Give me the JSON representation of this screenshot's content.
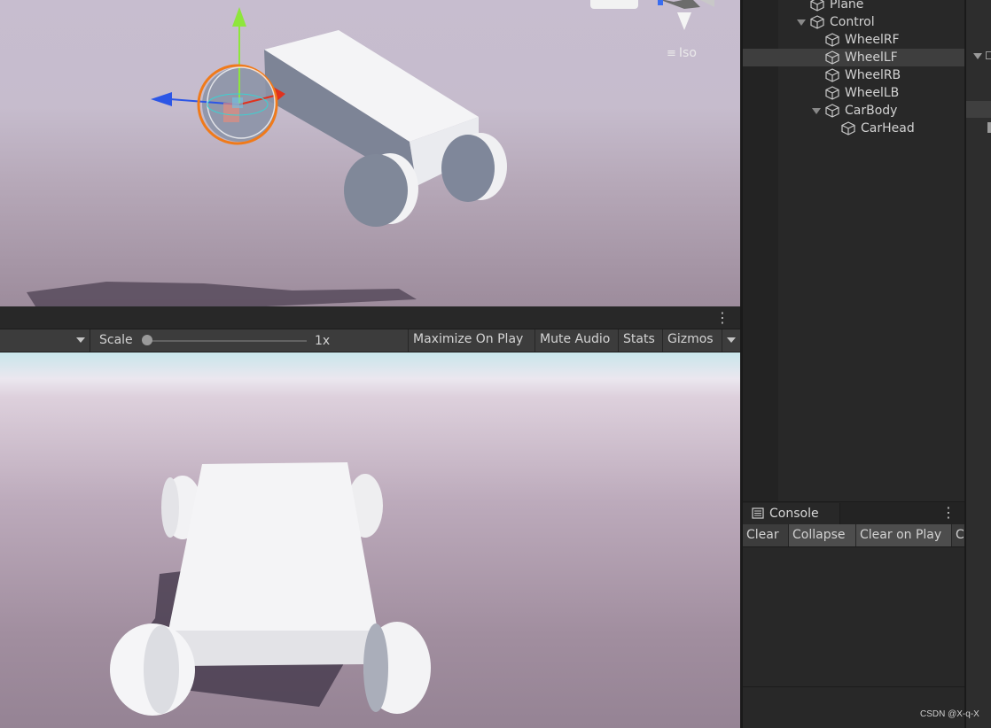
{
  "scene_view": {
    "overlay_label": "Iso"
  },
  "game_toolbar": {
    "scale_label": "Scale",
    "scale_value": "1x",
    "buttons": [
      {
        "label": "Maximize On Play"
      },
      {
        "label": "Mute Audio"
      },
      {
        "label": "Stats"
      },
      {
        "label": "Gizmos"
      }
    ]
  },
  "hierarchy": {
    "items": [
      {
        "label": "Plane",
        "depth": 0
      },
      {
        "label": "Control",
        "depth": 0,
        "expanded": true
      },
      {
        "label": "WheelRF",
        "depth": 1
      },
      {
        "label": "WheelLF",
        "depth": 1,
        "selected": true
      },
      {
        "label": "WheelRB",
        "depth": 1
      },
      {
        "label": "WheelLB",
        "depth": 1
      },
      {
        "label": "CarBody",
        "depth": 1,
        "expanded": true
      },
      {
        "label": "CarHead",
        "depth": 2
      }
    ]
  },
  "console": {
    "tab_label": "Console",
    "buttons": [
      {
        "label": "Clear"
      },
      {
        "label": "Collapse",
        "active": true
      },
      {
        "label": "Clear on Play",
        "active": true
      },
      {
        "label": "C"
      }
    ]
  },
  "watermark": "CSDN @X-q-X",
  "colors": {
    "panel_bg": "#282828",
    "toolbar_bg": "#3c3c3c",
    "selection_bg": "#3e3e3e",
    "gizmo_orange": "#f07a1a",
    "axis_y": "#8ee63c",
    "axis_x": "#e0321e",
    "axis_z": "#2c56e6"
  }
}
